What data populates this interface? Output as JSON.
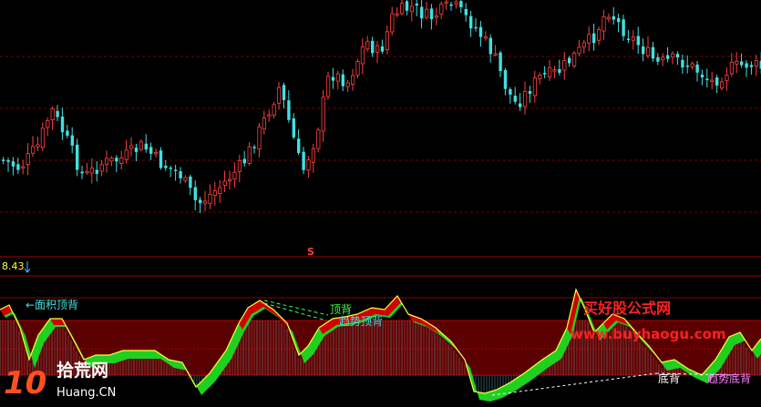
{
  "main_panel": {
    "low_price_label": "8.43",
    "signal_marker": "S"
  },
  "indicator_panel": {
    "annotations": {
      "area_top_divergence": "←面积顶背",
      "top_divergence": "顶背",
      "trend_top_divergence": "趋势顶背",
      "bottom_divergence": "底背",
      "trend_bottom_divergence": "趋势底背"
    }
  },
  "watermark": {
    "site_cn": "买好股公式网",
    "site_url": "www.buyhaogu.com",
    "logo_number": "10",
    "logo_cn": "拾荒网",
    "logo_domain": "Huang.CN"
  },
  "colors": {
    "background": "#000000",
    "up_candle": "#ff4040",
    "down_candle": "#40e0e0",
    "grid": "#7a0000",
    "area_fill": "#5a0000",
    "osc_line": "#ffff40",
    "osc_green": "#20d020",
    "osc_red": "#d00000",
    "annotation_cyan": "#40e0e0",
    "annotation_white": "#ffffff",
    "annotation_violet": "#ff80ff",
    "watermark_red": "#ff2020"
  }
}
